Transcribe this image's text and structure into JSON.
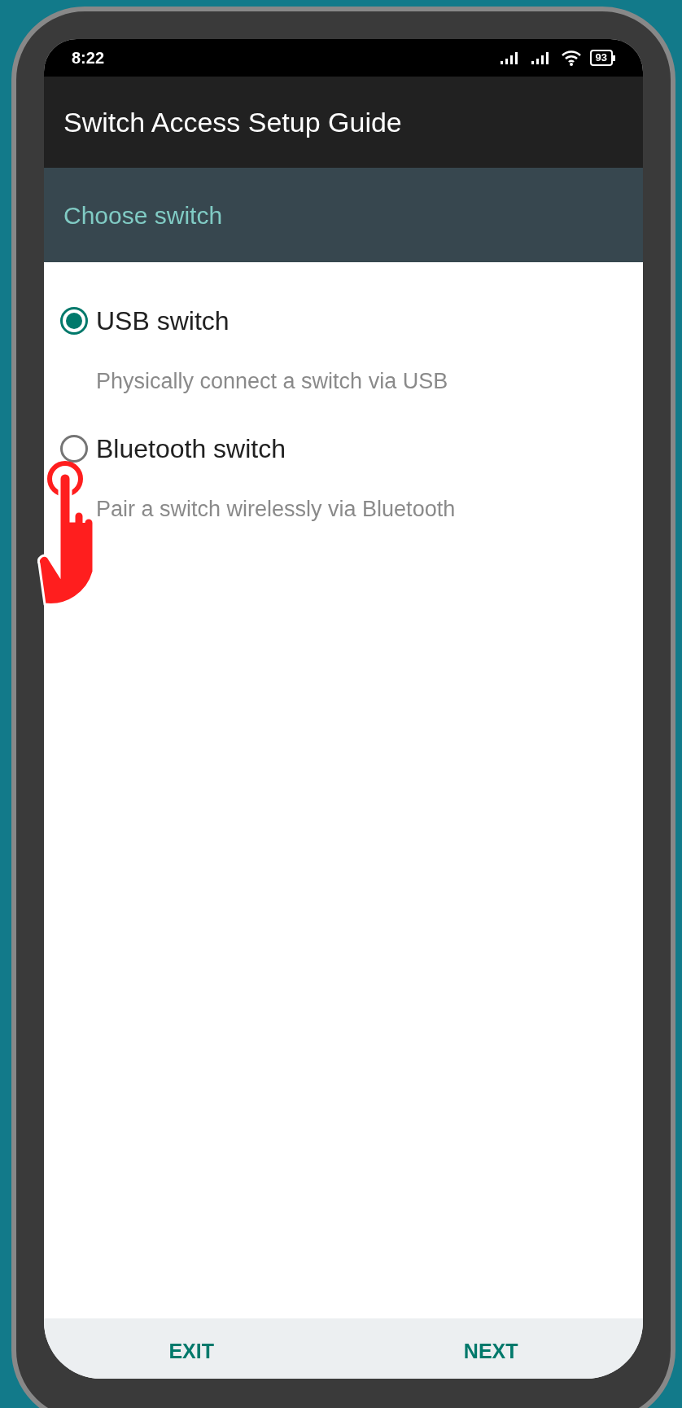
{
  "status_bar": {
    "time": "8:22",
    "battery": "93"
  },
  "app_bar": {
    "title": "Switch Access Setup Guide"
  },
  "section": {
    "title": "Choose switch"
  },
  "options": [
    {
      "label": "USB switch",
      "description": "Physically connect a switch via USB",
      "selected": true
    },
    {
      "label": "Bluetooth switch",
      "description": "Pair a switch wirelessly via Bluetooth",
      "selected": false
    }
  ],
  "buttons": [
    "EXIT",
    "NEXT"
  ]
}
